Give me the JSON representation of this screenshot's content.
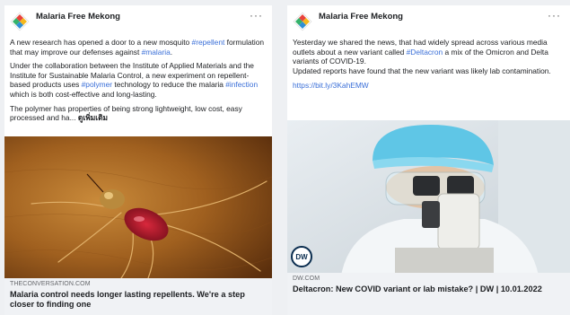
{
  "posts": [
    {
      "page_name": "Malaria Free Mekong",
      "more_label": "···",
      "text_1_plain": "A new research has opened a door to a new mosquito ",
      "text_1_tag": "#repellent",
      "text_1_rest": " formulation that may improve our defenses against ",
      "text_1_tag2": "#malaria",
      "text_1_end": ".",
      "text_2_a": "Under the collaboration between the Institute of Applied Materials and the Institute for Sustainable Malaria Control, a new experiment on repellent-based products uses ",
      "text_2_tag": "#polymer",
      "text_2_b": " technology to reduce the malaria ",
      "text_2_tag2": "#infection",
      "text_2_c": " which is both cost-effective and long-lasting.",
      "text_3": "The polymer has properties of being strong lightweight, low cost, easy processed and ha... ",
      "see_more": "ดูเพิ่มเติม",
      "link_domain": "THECONVERSATION.COM",
      "link_headline": "Malaria control needs longer lasting repellents. We're a step closer to finding one"
    },
    {
      "page_name": "Malaria Free Mekong",
      "more_label": "···",
      "text_1_a": "Yesterday we shared the news, that had widely spread across various media outlets about a new variant called ",
      "text_1_tag": "#Deltacron",
      "text_1_b": " a mix of the Omicron and Delta variants of COVID-19.",
      "text_2": "Updated reports have found that the new variant was likely lab contamination.",
      "url": "https://bit.ly/3KahEMW",
      "dw_logo": "DW",
      "link_domain": "DW.COM",
      "link_headline": "Deltacron: New COVID variant or lab mistake? | DW | 10.01.2022"
    }
  ],
  "colors": {
    "link": "#3a6fd8",
    "background": "#eef0f3",
    "footer": "#f0f2f5"
  }
}
